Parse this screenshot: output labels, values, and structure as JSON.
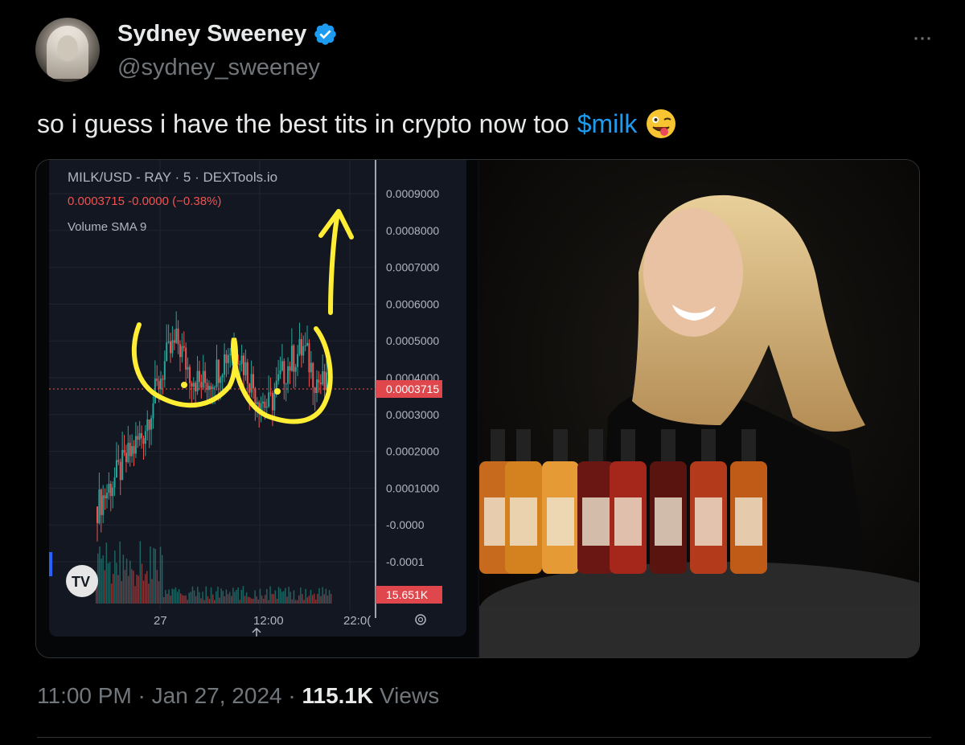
{
  "tweet": {
    "author_name": "Sydney Sweeney",
    "handle": "@sydney_sweeney",
    "text_before": "so i guess i have the best tits in crypto now too",
    "cashtag": "$milk",
    "time": "11:00 PM",
    "sep1": " · ",
    "date": "Jan 27, 2024",
    "sep2": " · ",
    "views_count": "115.1K",
    "views_label": " Views",
    "more_label": "···"
  },
  "chart": {
    "title": "MILK/USD - RAY · 5 · DEXTools.io",
    "quote": "0.0003715  -0.0000 (−0.38%)",
    "indicator": "Volume SMA 9",
    "current_price_label": "0.0003715",
    "volume_label": "15.651K",
    "price_ticks": [
      "0.0009000",
      "0.0008000",
      "0.0007000",
      "0.0006000",
      "0.0005000",
      "0.0004000",
      "0.0003000",
      "0.0002000",
      "0.0001000",
      "-0.0000",
      "-0.0001"
    ],
    "time_ticks": [
      "27",
      "12:00",
      "22:0("
    ],
    "logo_text": "TV",
    "colors": {
      "up": "#26a69a",
      "down": "#ef5350",
      "marker": "#ffee33",
      "price_tag": "#e0474c"
    }
  },
  "chart_data": {
    "type": "candlestick",
    "title": "MILK/USD - RAY · 5 · DEXTools.io",
    "last_price": 0.0003715,
    "ylim": [
      -0.0001,
      0.0009
    ],
    "x_ticks": [
      "27",
      "12:00",
      "22:0("
    ],
    "y_ticks": [
      0.0009,
      0.0008,
      0.0007,
      0.0006,
      0.0005,
      0.0004,
      0.0003,
      0.0002,
      0.0001,
      0,
      -0.0001
    ],
    "approx_close_path": [
      5e-05,
      0.0001,
      0.00015,
      0.0002,
      0.00025,
      0.00035,
      0.00045,
      0.0005,
      0.00042,
      0.00038,
      0.0004,
      0.00045,
      0.0005,
      0.00042,
      0.00035,
      0.00032,
      0.0004,
      0.00045,
      0.00048,
      0.0004,
      0.00037
    ],
    "volume_last": "15.651K"
  }
}
